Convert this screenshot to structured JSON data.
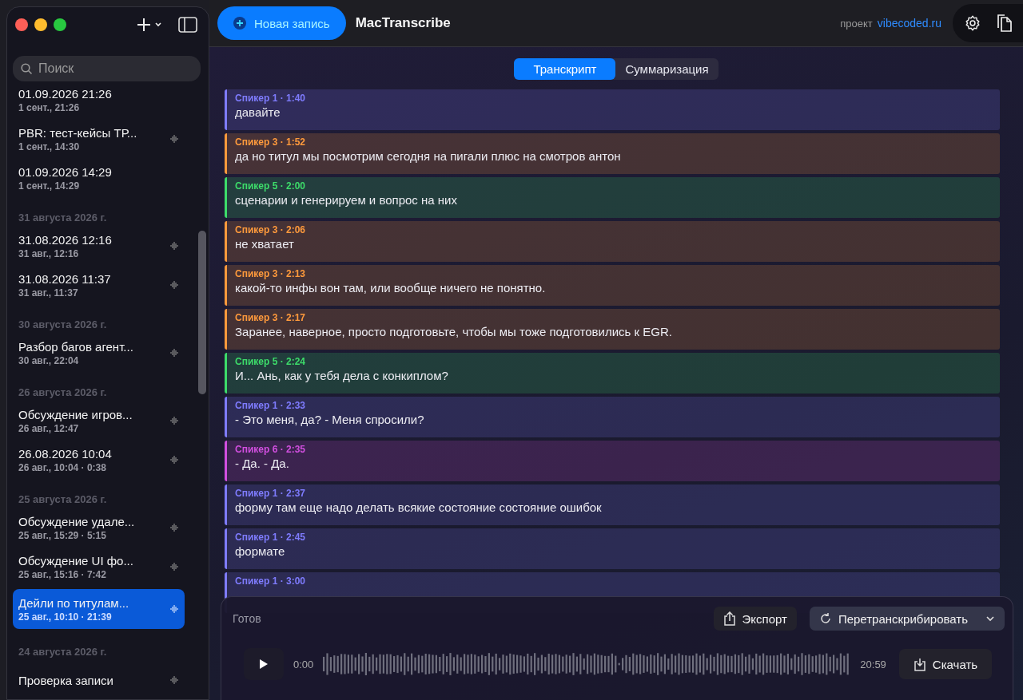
{
  "search": {
    "placeholder": "Поиск"
  },
  "sidebar": {
    "groups": [
      {
        "items": [
          {
            "title": "01.09.2026 21:26",
            "subtitle": "1 сент., 21:26",
            "has_audio": false,
            "selected": false
          },
          {
            "title": "PBR: тест-кейсы ТР...",
            "subtitle": "1 сент., 14:30",
            "has_audio": true,
            "selected": false
          },
          {
            "title": "01.09.2026 14:29",
            "subtitle": "1 сент., 14:29",
            "has_audio": false,
            "selected": false
          }
        ]
      },
      {
        "heading": "31 августа 2026 г.",
        "items": [
          {
            "title": "31.08.2026 12:16",
            "subtitle": "31 авг., 12:16",
            "has_audio": true,
            "selected": false
          },
          {
            "title": "31.08.2026 11:37",
            "subtitle": "31 авг., 11:37",
            "has_audio": true,
            "selected": false
          }
        ]
      },
      {
        "heading": "30 августа 2026 г.",
        "items": [
          {
            "title": "Разбор багов агент...",
            "subtitle": "30 авг., 22:04",
            "has_audio": true,
            "selected": false
          }
        ]
      },
      {
        "heading": "26 августа 2026 г.",
        "items": [
          {
            "title": "Обсуждение игров...",
            "subtitle": "26 авг., 12:47",
            "has_audio": true,
            "selected": false
          },
          {
            "title": "26.08.2026 10:04",
            "subtitle": "26 авг., 10:04 · 0:38",
            "has_audio": true,
            "selected": false
          }
        ]
      },
      {
        "heading": "25 августа 2026 г.",
        "items": [
          {
            "title": "Обсуждение удале...",
            "subtitle": "25 авг., 15:29 · 5:15",
            "has_audio": true,
            "selected": false
          },
          {
            "title": "Обсуждение UI фо...",
            "subtitle": "25 авг., 15:16 · 7:42",
            "has_audio": true,
            "selected": false
          },
          {
            "title": "Дейли по титулам...",
            "subtitle": "25 авг., 10:10 · 21:39",
            "has_audio": true,
            "selected": true
          }
        ]
      },
      {
        "heading": "24 августа 2026 г.",
        "items": [
          {
            "title": "Проверка записи",
            "has_audio": true,
            "selected": false
          }
        ]
      }
    ]
  },
  "toolbar": {
    "new_button": "Новая запись",
    "app_title": "MacTranscribe",
    "project_label": "проект",
    "project_link": "vibecoded.ru"
  },
  "tabs": [
    {
      "label": "Транскрипт",
      "selected": true
    },
    {
      "label": "Суммаризация",
      "selected": false
    }
  ],
  "transcript": [
    {
      "speaker": "Спикер 1 · 1:40",
      "text": "давайте",
      "color": "#7f7cff"
    },
    {
      "speaker": "Спикер 3 · 1:52",
      "text": "да но титул мы посмотрим сегодня на пигали плюс на смотров антон",
      "color": "#ff9a3c"
    },
    {
      "speaker": "Спикер 5 · 2:00",
      "text": "сценарии и генерируем и вопрос на них",
      "color": "#3ddc6a"
    },
    {
      "speaker": "Спикер 3 · 2:06",
      "text": "не хватает",
      "color": "#ff9a3c"
    },
    {
      "speaker": "Спикер 3 · 2:13",
      "text": "какой-то инфы вон там, или вообще ничего не понятно.",
      "color": "#ff9a3c"
    },
    {
      "speaker": "Спикер 3 · 2:17",
      "text": "Заранее, наверное, просто подготовьте, чтобы мы тоже подготовились к EGR.",
      "color": "#ff9a3c"
    },
    {
      "speaker": "Спикер 5 · 2:24",
      "text": "И... Ань, как у тебя дела с конкиплом?",
      "color": "#3ddc6a"
    },
    {
      "speaker": "Спикер 1 · 2:33",
      "text": "- Это меня, да? - Меня спросили?",
      "color": "#7f7cff"
    },
    {
      "speaker": "Спикер 6 · 2:35",
      "text": "- Да. - Да.",
      "color": "#d24fe0"
    },
    {
      "speaker": "Спикер 1 · 2:37",
      "text": "форму там еще надо делать всякие состояние состояние ошибок",
      "color": "#7f7cff"
    },
    {
      "speaker": "Спикер 1 · 2:45",
      "text": "формате",
      "color": "#7f7cff"
    },
    {
      "speaker": "Спикер 1 · 3:00",
      "color": "#7f7cff"
    }
  ],
  "player": {
    "status": "Готов",
    "export_button": "Экспорт",
    "retranscribe_button": "Перетранскрибировать",
    "time_start": "0:00",
    "time_end": "20:59",
    "download_button": "Скачать"
  }
}
